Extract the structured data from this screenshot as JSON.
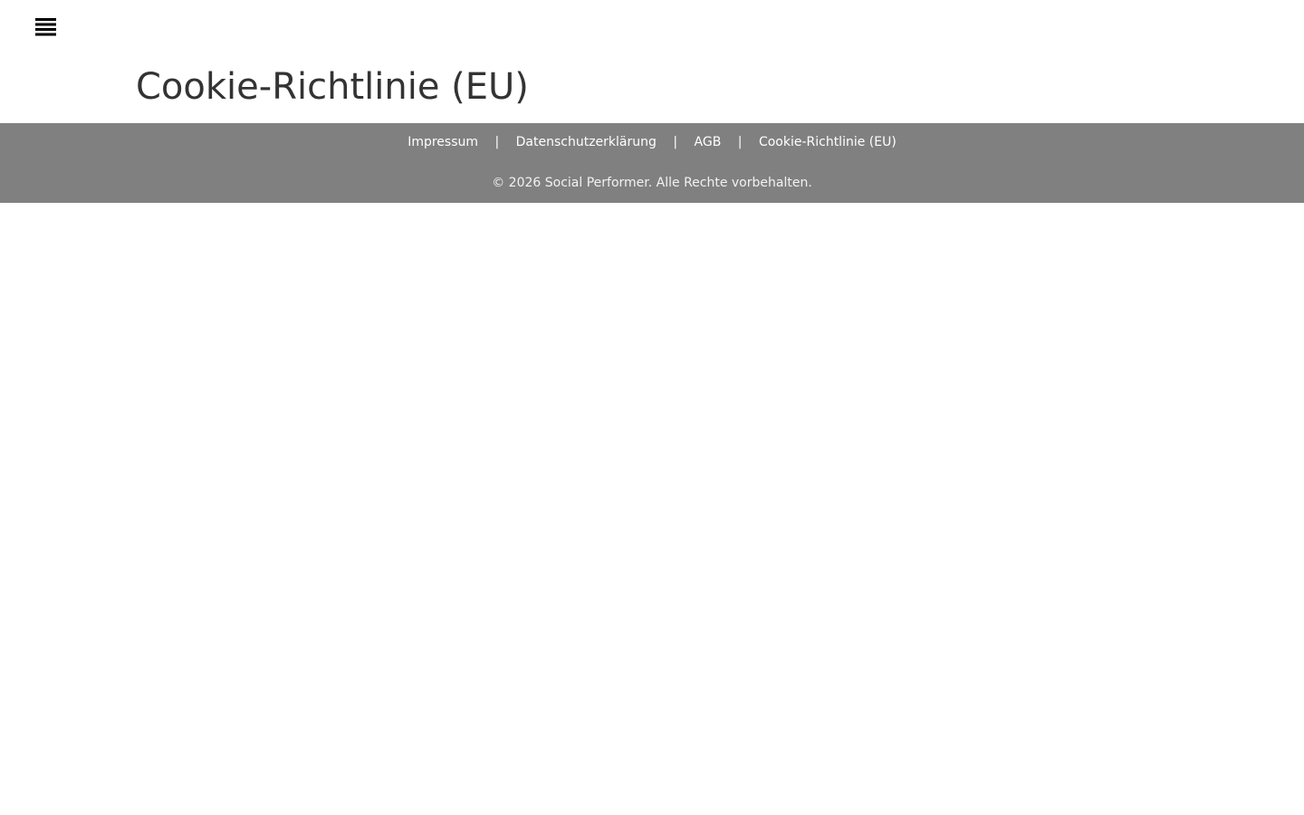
{
  "header": {
    "menu_icon": "menu-lines-icon"
  },
  "page": {
    "title": "Cookie-Richtlinie (EU)"
  },
  "footer": {
    "links": [
      {
        "label": "Impressum"
      },
      {
        "label": "Datenschutzerklärung"
      },
      {
        "label": "AGB"
      },
      {
        "label": "Cookie-Richtlinie (EU)"
      }
    ],
    "separator": "|",
    "copyright": "© 2026 Social Performer. Alle Rechte vorbehalten.",
    "background_color": "#808080",
    "text_color": "#ffffff"
  }
}
